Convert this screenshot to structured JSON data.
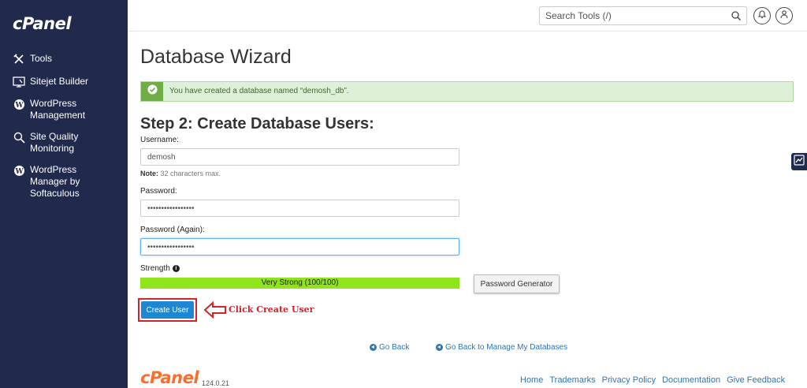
{
  "sidebar": {
    "logo": "cPanel",
    "items": [
      {
        "label": "Tools",
        "icon": "tools-icon"
      },
      {
        "label": "Sitejet Builder",
        "icon": "sitejet-icon"
      },
      {
        "label": "WordPress\nManagement",
        "icon": "wordpress-icon"
      },
      {
        "label": "Site Quality\nMonitoring",
        "icon": "search-monitor-icon"
      },
      {
        "label": "WordPress\nManager by\nSoftaculous",
        "icon": "wordpress-icon"
      }
    ]
  },
  "topbar": {
    "search_placeholder": "Search Tools (/)"
  },
  "main": {
    "title": "Database Wizard",
    "alert": "You have created a database named “demosh_db”.",
    "step_title": "Step 2: Create Database Users:",
    "username_label": "Username:",
    "username_value": "demosh",
    "note_bold": "Note:",
    "note_text": " 32 characters max.",
    "password_label": "Password:",
    "password_value": "•••••••••••••••••",
    "password_again_label": "Password (Again):",
    "password_again_value": "•••••••••••••••••",
    "strength_label": "Strength",
    "strength_text": "Very Strong (100/100)",
    "strength_value": 100,
    "password_generator": "Password Generator",
    "create_user": "Create User",
    "annotation": "Click Create User",
    "go_back": "Go Back",
    "go_back_manage": "Go Back to Manage My Databases"
  },
  "footer": {
    "logo": "cPanel",
    "version": "124.0.21",
    "links": [
      "Home",
      "Trademarks",
      "Privacy Policy",
      "Documentation",
      "Give Feedback"
    ]
  },
  "colors": {
    "sidebar_bg": "#1f2a4d",
    "primary_button": "#1e87d3",
    "success_bg": "#dff0d8",
    "strength_fill": "#8fe51b",
    "annotation_red": "#d3232b",
    "footer_logo": "#ff6c2c"
  }
}
